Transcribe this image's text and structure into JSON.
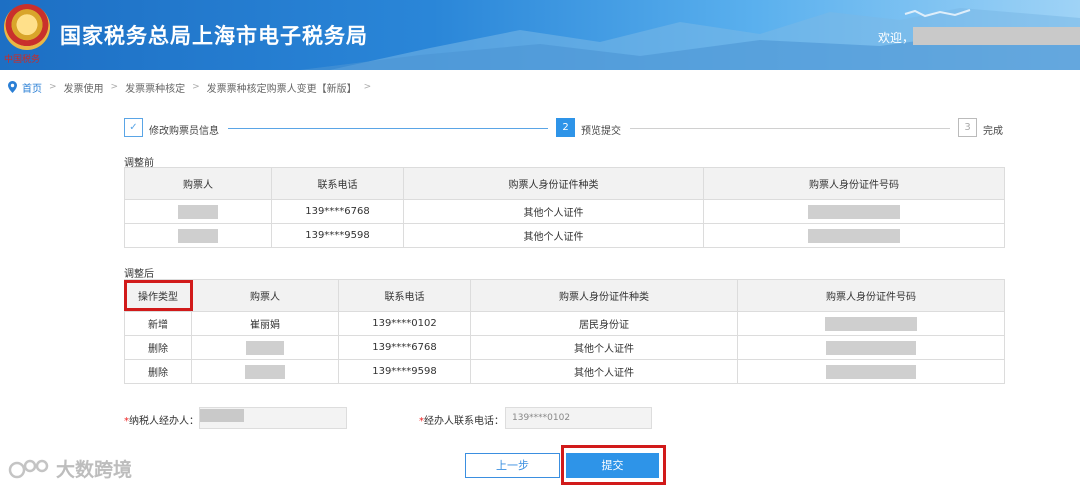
{
  "header": {
    "site_title": "国家税务总局上海市电子税务局",
    "welcome": "欢迎，",
    "seal_text": "中国税务"
  },
  "breadcrumb": [
    "首页",
    "发票使用",
    "发票票种核定",
    "发票票种核定购票人变更【新版】"
  ],
  "steps": [
    {
      "num": "✓",
      "label": "修改购票员信息",
      "state": "done"
    },
    {
      "num": "2",
      "label": "预览提交",
      "state": "active"
    },
    {
      "num": "3",
      "label": "完成",
      "state": "pending"
    }
  ],
  "before": {
    "title": "调整前",
    "columns": [
      "购票人",
      "联系电话",
      "购票人身份证件种类",
      "购票人身份证件号码"
    ],
    "rows": [
      {
        "phone": "139****6768",
        "id_type": "其他个人证件"
      },
      {
        "phone": "139****9598",
        "id_type": "其他个人证件"
      }
    ]
  },
  "after": {
    "title": "调整后",
    "columns": [
      "操作类型",
      "购票人",
      "联系电话",
      "购票人身份证件种类",
      "购票人身份证件号码"
    ],
    "rows": [
      {
        "op": "新增",
        "name": "崔丽娟",
        "phone": "139****0102",
        "id_type": "居民身份证"
      },
      {
        "op": "删除",
        "name": "",
        "phone": "139****6768",
        "id_type": "其他个人证件"
      },
      {
        "op": "删除",
        "name": "",
        "phone": "139****9598",
        "id_type": "其他个人证件"
      }
    ]
  },
  "form": {
    "required_mark": "*",
    "agent_label": "纳税人经办人：",
    "agent_phone_label": "经办人联系电话：",
    "agent_phone_value": "139****0102"
  },
  "buttons": {
    "prev": "上一步",
    "submit": "提交"
  },
  "watermark": "大数跨境",
  "colors": {
    "accent": "#2e94e8",
    "highlight": "#d11a1a",
    "header": "#1d6fc4"
  }
}
